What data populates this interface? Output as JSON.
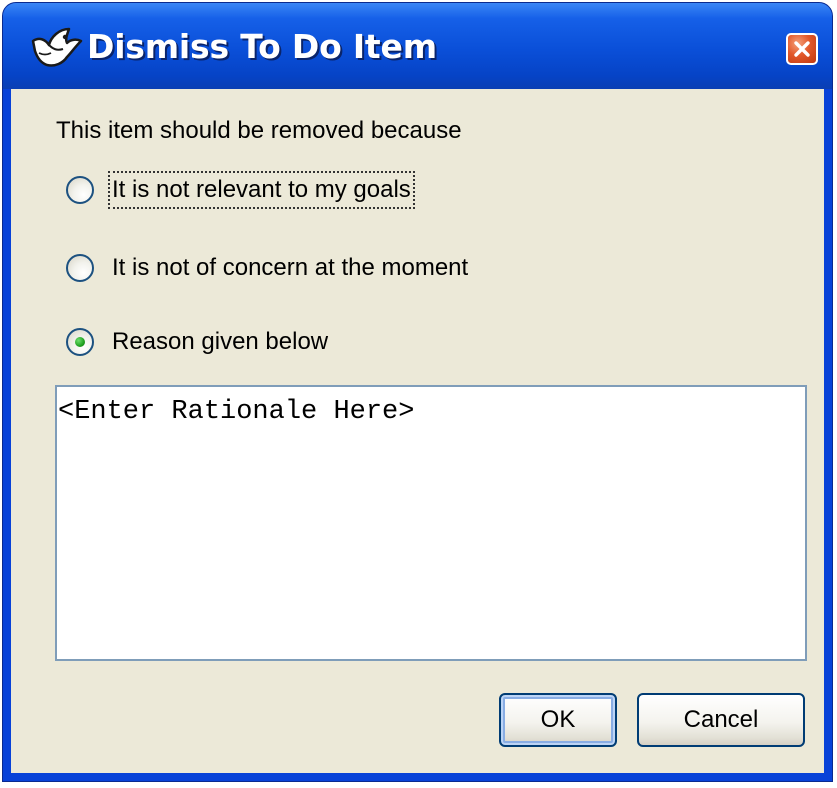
{
  "window": {
    "title": "Dismiss To Do Item"
  },
  "titlebar": {
    "icon": "argo-bird-icon",
    "close_icon": "close-icon"
  },
  "dialog": {
    "prompt": "This item should be removed because",
    "options": [
      {
        "label": "It is not relevant to my goals",
        "selected": false,
        "focused": true,
        "mnemonic": "g"
      },
      {
        "label": "It is not of concern at the moment",
        "selected": false,
        "focused": false,
        "mnemonic": "c"
      },
      {
        "label": "Reason given below",
        "selected": true,
        "focused": false,
        "mnemonic": "R"
      }
    ],
    "rationale_value": "<Enter Rationale Here>"
  },
  "buttons": {
    "ok": "OK",
    "cancel": "Cancel"
  },
  "colors": {
    "titlebar": "#0a4fd8",
    "dialog_background": "#ece9d8",
    "close_button": "#e2582a",
    "radio_selected": "#21a121"
  }
}
